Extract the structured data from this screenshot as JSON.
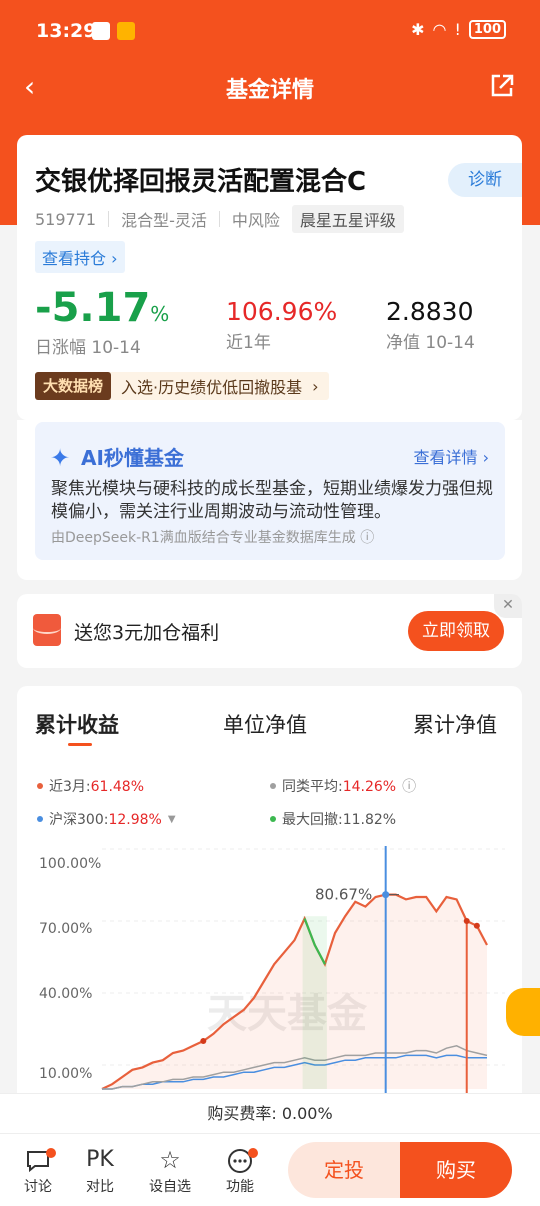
{
  "status_bar": {
    "time": "13:29",
    "battery": "100"
  },
  "nav": {
    "title": "基金详情"
  },
  "fund": {
    "name": "交银优择回报灵活配置混合C",
    "diagnose_label": "诊断",
    "code": "519771",
    "type": "混合型-灵活",
    "risk": "中风险",
    "rating": "晨星五星评级",
    "holdings_link": "查看持仓 ›",
    "daily_change": "-5.17",
    "daily_change_unit": "%",
    "daily_change_label": "日涨幅 10-14",
    "year_return": "106.96%",
    "year_return_label": "近1年",
    "nav_value": "2.8830",
    "nav_label": "净值 10-14",
    "bigdata_tag": "大数据榜",
    "bigdata_text": "入选·历史绩优低回撤股基",
    "bigdata_arrow": "›"
  },
  "ai": {
    "title": "AI秒懂基金",
    "more": "查看详情 ›",
    "summary": "聚焦光模块与硬科技的成长型基金，短期业绩爆发力强但规模偏小，需关注行业周期波动与流动性管理。",
    "source": "由DeepSeek-R1满血版结合专业基金数据库生成 ⓘ"
  },
  "promo": {
    "text": "送您3元加仓福利",
    "button": "立即领取",
    "close": "✕"
  },
  "tabs": [
    "累计收益",
    "单位净值",
    "累计净值"
  ],
  "legend": {
    "fund_label": "近3月:",
    "fund_value": "61.48%",
    "peer_label": "同类平均:",
    "peer_value": "14.26%",
    "index_label": "沪深300:",
    "index_value": "12.98%",
    "drawdown_label": "最大回撤:",
    "drawdown_value": "11.82%"
  },
  "colors": {
    "brand": "#f4511e",
    "fund_line": "#e8603c",
    "index_line": "#4a8ee0",
    "peer_line": "#a0a0a0",
    "drawdown": "#3cb850"
  },
  "chart_data": {
    "type": "line",
    "ylim": [
      0,
      100
    ],
    "yticks": [
      "100.00%",
      "70.00%",
      "40.00%",
      "10.00%"
    ],
    "peak_label": "80.67%",
    "watermark": "天天基金",
    "series": [
      {
        "name": "近3月",
        "values": [
          0,
          2,
          5,
          8,
          9,
          11,
          12,
          15,
          16,
          18,
          20,
          23,
          27,
          30,
          33,
          38,
          45,
          52,
          57,
          62,
          71,
          60,
          52,
          65,
          72,
          78,
          76,
          80,
          81,
          81,
          79,
          80,
          80,
          74,
          80,
          79,
          70,
          68,
          60
        ]
      },
      {
        "name": "沪深300",
        "values": [
          0,
          0,
          1,
          1,
          2,
          2,
          3,
          3,
          3,
          4,
          4,
          5,
          5,
          6,
          7,
          7,
          8,
          9,
          9,
          10,
          11,
          10,
          10,
          11,
          12,
          12,
          13,
          13,
          13,
          13,
          14,
          14,
          14,
          13,
          14,
          14,
          13,
          13,
          13
        ]
      },
      {
        "name": "同类平均",
        "values": [
          0,
          0,
          1,
          1,
          2,
          3,
          3,
          4,
          4,
          5,
          5,
          6,
          7,
          7,
          8,
          9,
          10,
          11,
          11,
          12,
          13,
          12,
          12,
          13,
          14,
          14,
          14,
          15,
          15,
          15,
          15,
          16,
          16,
          15,
          17,
          18,
          16,
          15,
          14
        ]
      }
    ]
  },
  "footer": {
    "fee": "购买费率: 0.00%",
    "items": [
      "讨论",
      "对比",
      "设自选",
      "功能"
    ],
    "pk": "PK",
    "dingtou": "定投",
    "buy": "购买"
  }
}
